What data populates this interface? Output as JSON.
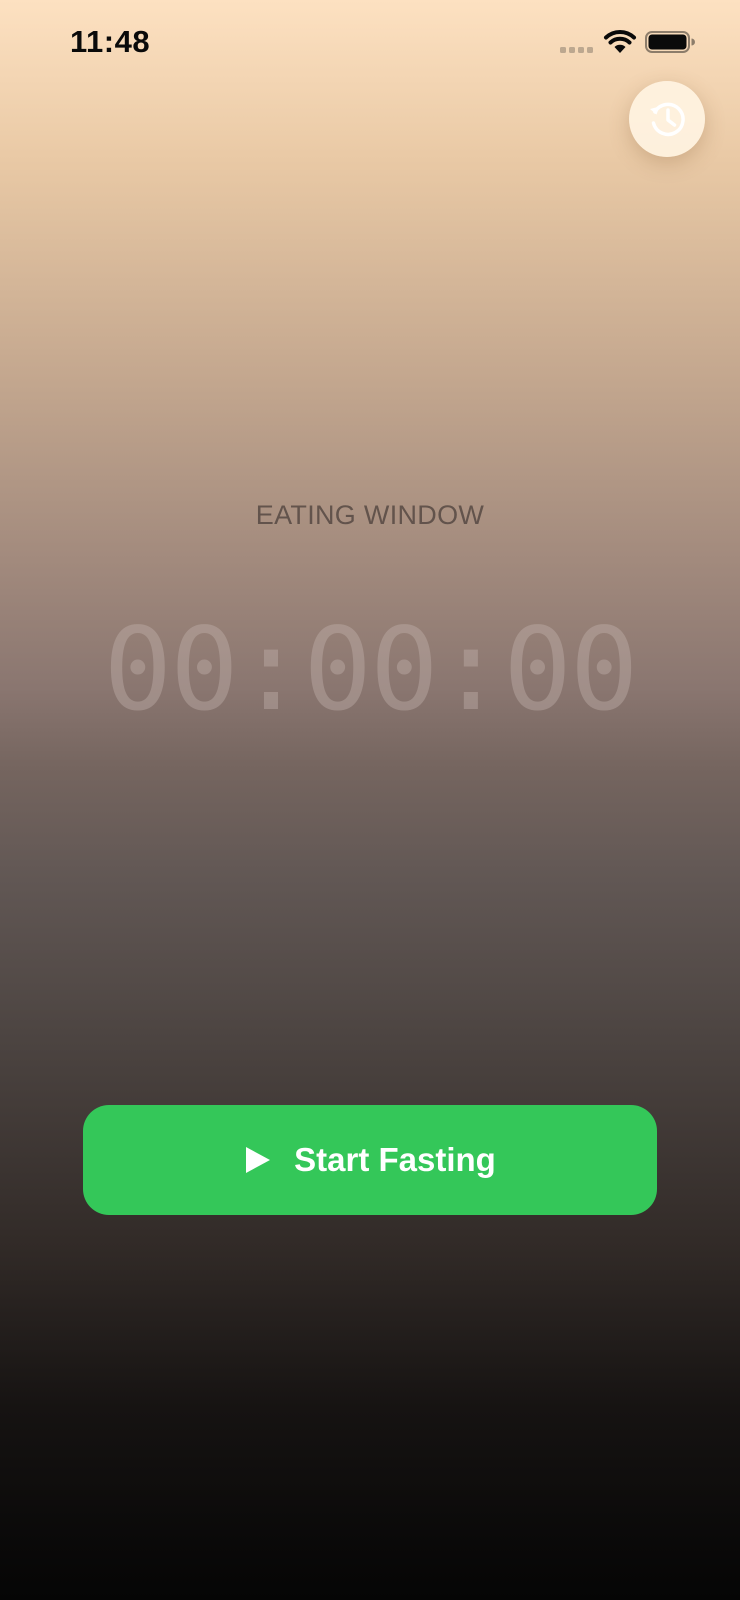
{
  "status_bar": {
    "time": "11:48",
    "icons": [
      "cellular-signal-icon",
      "wifi-icon",
      "battery-icon"
    ]
  },
  "history_button": {
    "icon": "history-icon"
  },
  "timer": {
    "mode_label": "EATING WINDOW",
    "display": "00:00:00"
  },
  "start_button": {
    "label": "Start Fasting",
    "icon": "play-icon",
    "color": "#34c759"
  },
  "colors": {
    "gradient_top": "#fde1c1",
    "gradient_bottom": "#050505",
    "history_button_bg": "#fff4e2"
  }
}
